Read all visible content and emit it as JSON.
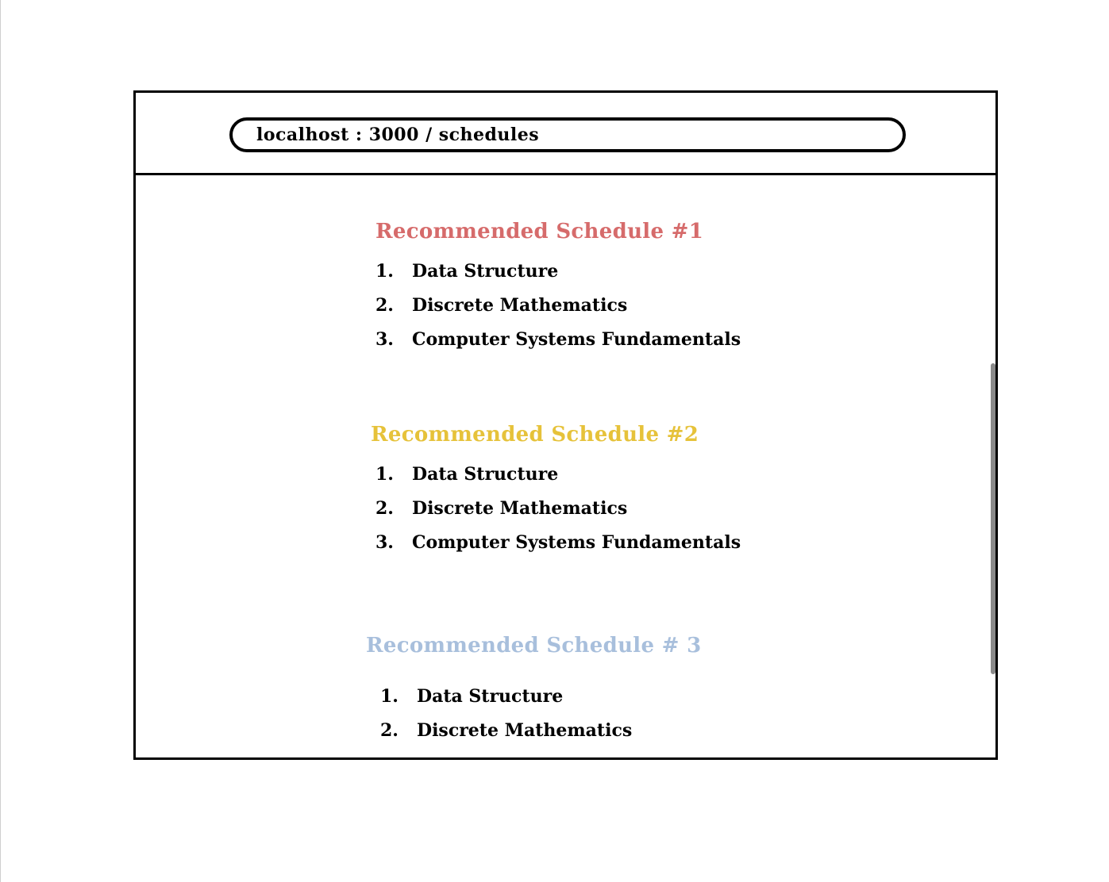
{
  "browser": {
    "url": "localhost : 3000 / schedules"
  },
  "schedules": [
    {
      "title": "Recommended Schedule #1",
      "color": "#d66b6b",
      "courses": [
        {
          "num": "1.",
          "name": "Data Structure"
        },
        {
          "num": "2.",
          "name": "Discrete Mathematics"
        },
        {
          "num": "3.",
          "name": "Computer Systems Fundamentals"
        }
      ]
    },
    {
      "title": "Recommended Schedule #2",
      "color": "#e6c23a",
      "courses": [
        {
          "num": "1.",
          "name": "Data Structure"
        },
        {
          "num": "2.",
          "name": "Discrete Mathematics"
        },
        {
          "num": "3.",
          "name": "Computer Systems Fundamentals"
        }
      ]
    },
    {
      "title": "Recommended Schedule # 3",
      "color": "#a8bfdc",
      "courses": [
        {
          "num": "1.",
          "name": "Data Structure"
        },
        {
          "num": "2.",
          "name": "Discrete Mathematics"
        }
      ]
    }
  ]
}
